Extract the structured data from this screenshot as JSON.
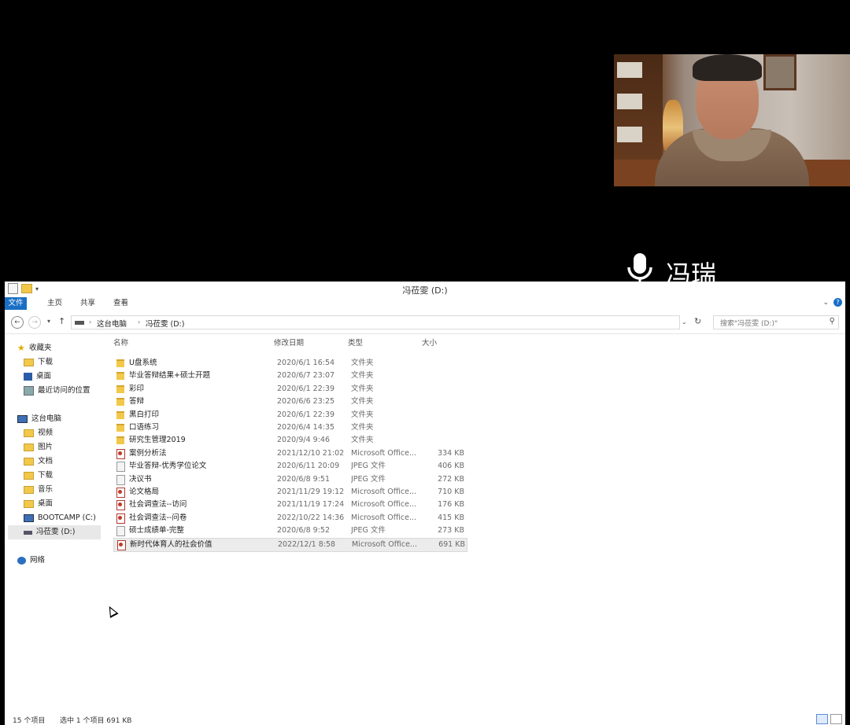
{
  "participant": {
    "name": "冯瑞"
  },
  "explorer": {
    "title": "冯莅雯 (D:)",
    "ribbon_tabs": [
      "文件",
      "主页",
      "共享",
      "查看"
    ],
    "breadcrumb": [
      "这台电脑",
      "冯莅雯 (D:)"
    ],
    "search_placeholder": "搜索\"冯莅雯 (D:)\"",
    "nav_pane": {
      "favorites": {
        "label": "收藏夹",
        "items": [
          "下载",
          "桌面",
          "最近访问的位置"
        ]
      },
      "this_pc": {
        "label": "这台电脑",
        "items": [
          "视频",
          "图片",
          "文档",
          "下载",
          "音乐",
          "桌面",
          "BOOTCAMP (C:)",
          "冯莅雯 (D:)"
        ]
      },
      "network": {
        "label": "网络"
      }
    },
    "columns": {
      "name": "名称",
      "date": "修改日期",
      "type": "类型",
      "size": "大小"
    },
    "files": [
      {
        "name": "U盘系统",
        "date": "2020/6/1 16:54",
        "type": "文件夹",
        "size": "",
        "kind": "folder"
      },
      {
        "name": "毕业答辩结果+硕士开题",
        "date": "2020/6/7 23:07",
        "type": "文件夹",
        "size": "",
        "kind": "folder"
      },
      {
        "name": "彩印",
        "date": "2020/6/1 22:39",
        "type": "文件夹",
        "size": "",
        "kind": "folder"
      },
      {
        "name": "答辩",
        "date": "2020/6/6 23:25",
        "type": "文件夹",
        "size": "",
        "kind": "folder"
      },
      {
        "name": "黑白打印",
        "date": "2020/6/1 22:39",
        "type": "文件夹",
        "size": "",
        "kind": "folder"
      },
      {
        "name": "口语练习",
        "date": "2020/6/4 14:35",
        "type": "文件夹",
        "size": "",
        "kind": "folder"
      },
      {
        "name": "研究生管理2019",
        "date": "2020/9/4 9:46",
        "type": "文件夹",
        "size": "",
        "kind": "folder"
      },
      {
        "name": "案例分析法",
        "date": "2021/12/10 21:02",
        "type": "Microsoft Office...",
        "size": "334 KB",
        "kind": "office"
      },
      {
        "name": "毕业答辩-优秀学位论文",
        "date": "2020/6/11 20:09",
        "type": "JPEG 文件",
        "size": "406 KB",
        "kind": "jpeg"
      },
      {
        "name": "决议书",
        "date": "2020/6/8 9:51",
        "type": "JPEG 文件",
        "size": "272 KB",
        "kind": "jpeg"
      },
      {
        "name": "论文格局",
        "date": "2021/11/29 19:12",
        "type": "Microsoft Office...",
        "size": "710 KB",
        "kind": "office"
      },
      {
        "name": "社会调查法--访问",
        "date": "2021/11/19 17:24",
        "type": "Microsoft Office...",
        "size": "176 KB",
        "kind": "office"
      },
      {
        "name": "社会调查法--问卷",
        "date": "2022/10/22 14:36",
        "type": "Microsoft Office...",
        "size": "415 KB",
        "kind": "office"
      },
      {
        "name": "硕士成绩单-完整",
        "date": "2020/6/8 9:52",
        "type": "JPEG 文件",
        "size": "273 KB",
        "kind": "jpeg"
      },
      {
        "name": "新时代体育人的社会价值",
        "date": "2022/12/1 8:58",
        "type": "Microsoft Office...",
        "size": "691 KB",
        "kind": "office",
        "selected": true
      }
    ],
    "status": {
      "count": "15 个项目",
      "selection": "选中 1 个项目  691 KB"
    }
  }
}
